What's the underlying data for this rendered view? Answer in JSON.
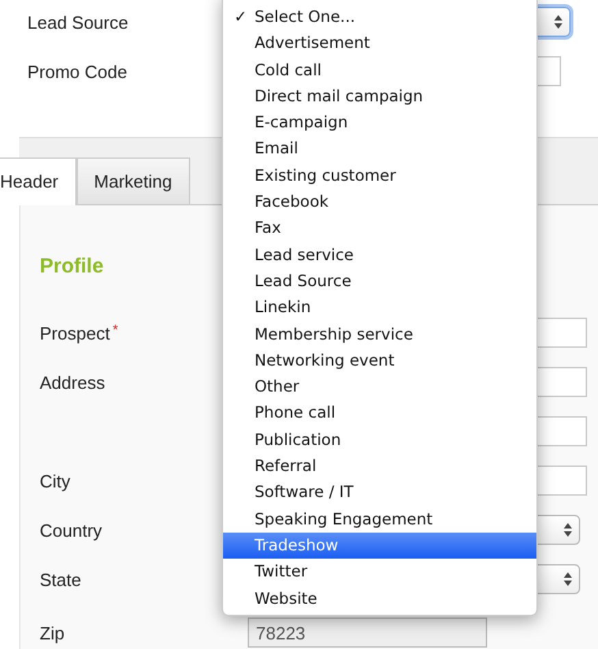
{
  "top_fields": [
    {
      "label": "Lead Source",
      "kind": "select"
    },
    {
      "label": "Promo Code",
      "kind": "input"
    }
  ],
  "tabs": [
    {
      "label": "Header",
      "selected": true
    },
    {
      "label": "Marketing",
      "selected": false
    }
  ],
  "section_title": "Profile",
  "required_mark": "*",
  "check_mark": "✓",
  "profile_fields": [
    {
      "label": "Prospect",
      "required": true,
      "kind": "input"
    },
    {
      "label": "Address",
      "required": false,
      "kind": "input"
    },
    {
      "kind": "input"
    },
    {
      "label": "City",
      "required": false,
      "kind": "input"
    },
    {
      "label": "Country",
      "required": false,
      "kind": "select"
    },
    {
      "label": "State",
      "required": false,
      "kind": "select"
    },
    {
      "label": "Zip",
      "required": false,
      "kind": "input",
      "value": "78223",
      "disabled": true
    }
  ],
  "menu": [
    {
      "label": "Select One...",
      "checked": true,
      "selected": false
    },
    {
      "label": "Advertisement",
      "checked": false,
      "selected": false
    },
    {
      "label": "Cold call",
      "checked": false,
      "selected": false
    },
    {
      "label": "Direct mail campaign",
      "checked": false,
      "selected": false
    },
    {
      "label": "E-campaign",
      "checked": false,
      "selected": false
    },
    {
      "label": "Email",
      "checked": false,
      "selected": false
    },
    {
      "label": "Existing customer",
      "checked": false,
      "selected": false
    },
    {
      "label": "Facebook",
      "checked": false,
      "selected": false
    },
    {
      "label": "Fax",
      "checked": false,
      "selected": false
    },
    {
      "label": "Lead service",
      "checked": false,
      "selected": false
    },
    {
      "label": "Lead Source",
      "checked": false,
      "selected": false
    },
    {
      "label": "Linekin",
      "checked": false,
      "selected": false
    },
    {
      "label": "Membership service",
      "checked": false,
      "selected": false
    },
    {
      "label": "Networking event",
      "checked": false,
      "selected": false
    },
    {
      "label": "Other",
      "checked": false,
      "selected": false
    },
    {
      "label": "Phone call",
      "checked": false,
      "selected": false
    },
    {
      "label": "Publication",
      "checked": false,
      "selected": false
    },
    {
      "label": "Referral",
      "checked": false,
      "selected": false
    },
    {
      "label": "Software / IT",
      "checked": false,
      "selected": false
    },
    {
      "label": "Speaking Engagement",
      "checked": false,
      "selected": false
    },
    {
      "label": "Tradeshow",
      "checked": false,
      "selected": true
    },
    {
      "label": "Twitter",
      "checked": false,
      "selected": false
    },
    {
      "label": "Website",
      "checked": false,
      "selected": false
    }
  ]
}
